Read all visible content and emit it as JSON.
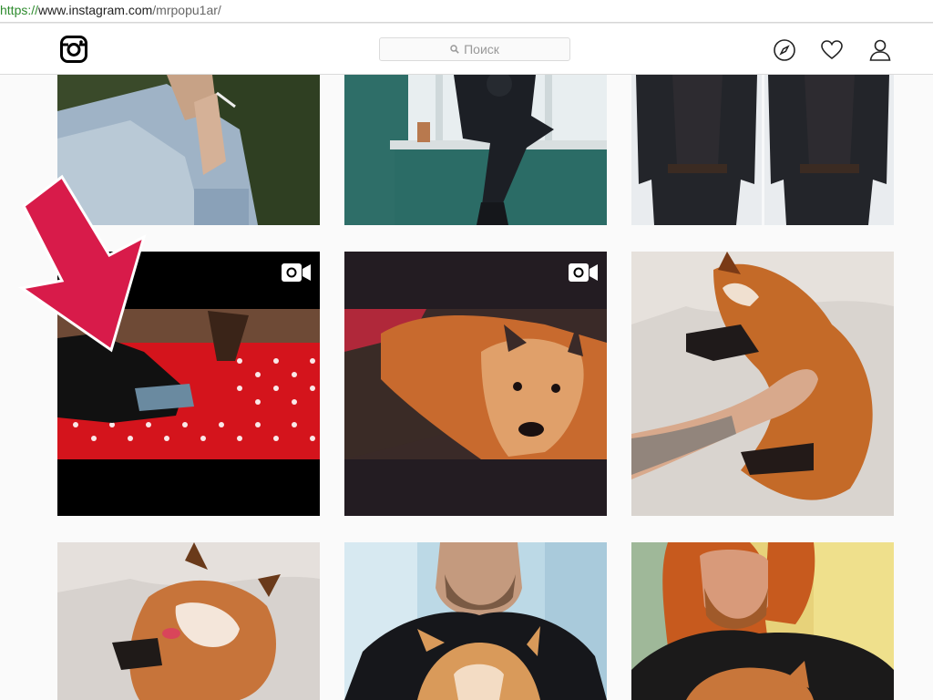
{
  "browser": {
    "url_scheme": "https://",
    "url_host": "www.instagram.com",
    "url_path": "/mrpopu1ar/"
  },
  "header": {
    "logo_icon": "instagram-logo-icon",
    "search_placeholder": "Поиск",
    "search_icon": "search-icon",
    "nav_icons": [
      "compass-icon",
      "heart-icon",
      "person-icon"
    ]
  },
  "grid": {
    "columns": 3,
    "posts": [
      {
        "label": "man-with-cigarette-denim-jacket",
        "type": "photo"
      },
      {
        "label": "man-sitting-on-window-teal-wall",
        "type": "photo"
      },
      {
        "label": "man-in-black-vest-two-shots",
        "type": "photo"
      },
      {
        "label": "fox-on-red-polka-dot-bed",
        "type": "video",
        "badge_icon": "video-camera-icon"
      },
      {
        "label": "fox-closeup-face",
        "type": "video",
        "badge_icon": "video-camera-icon"
      },
      {
        "label": "hand-petting-sleeping-fox",
        "type": "photo"
      },
      {
        "label": "fox-lying-on-white-sheet",
        "type": "photo"
      },
      {
        "label": "bearded-man-holding-fox",
        "type": "photo"
      },
      {
        "label": "red-haired-man-with-fox",
        "type": "photo"
      }
    ]
  },
  "annotation": {
    "arrow_color": "#d81b4a",
    "arrow_icon": "down-arrow-annotation"
  },
  "colors": {
    "background": "#fafafa",
    "header_border": "#dbdbdb",
    "text_muted": "#999999"
  }
}
